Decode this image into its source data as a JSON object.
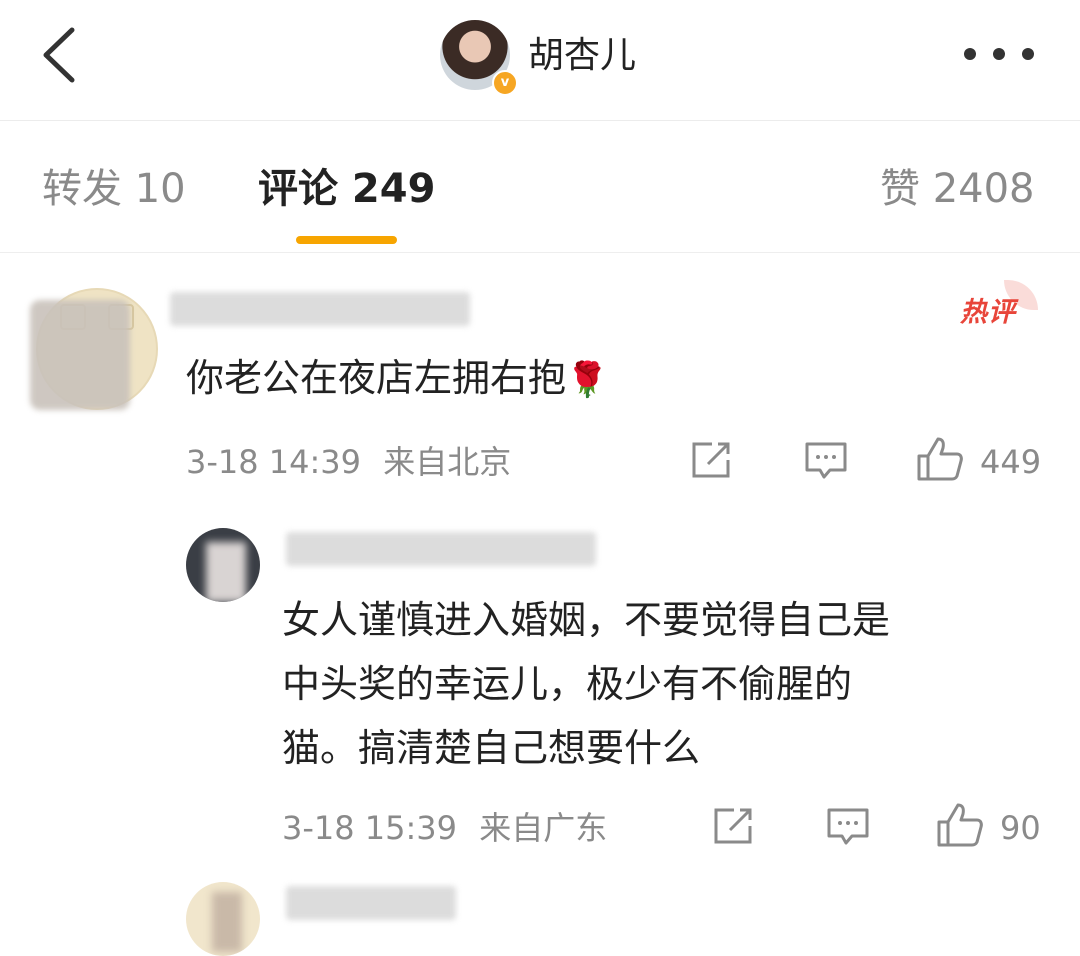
{
  "header": {
    "title": "胡杏儿",
    "verified_badge": "v",
    "back_icon": "chevron-left-icon",
    "more_icon": "more-horizontal-icon"
  },
  "tabs": [
    {
      "label": "转发 10",
      "active": false
    },
    {
      "label": "评论 249",
      "active": true
    },
    {
      "label": "赞 2408",
      "active": false
    }
  ],
  "accent_color": "#f7a500",
  "comments": [
    {
      "badge": "热评",
      "text": "你老公在夜店左拥右抱",
      "emoji": "🌹",
      "time": "3-18 14:39",
      "location": "来自北京",
      "likes": "449",
      "replies": [
        {
          "text_lines": [
            "女人谨慎进入婚姻，不要觉得自己是",
            "中头奖的幸运儿，极少有不偷腥的",
            "猫。搞清楚自己想要什么"
          ],
          "time": "3-18 15:39",
          "location": "来自广东",
          "likes": "90"
        }
      ]
    }
  ],
  "action_icons": [
    "share-icon",
    "comment-icon",
    "like-icon"
  ]
}
